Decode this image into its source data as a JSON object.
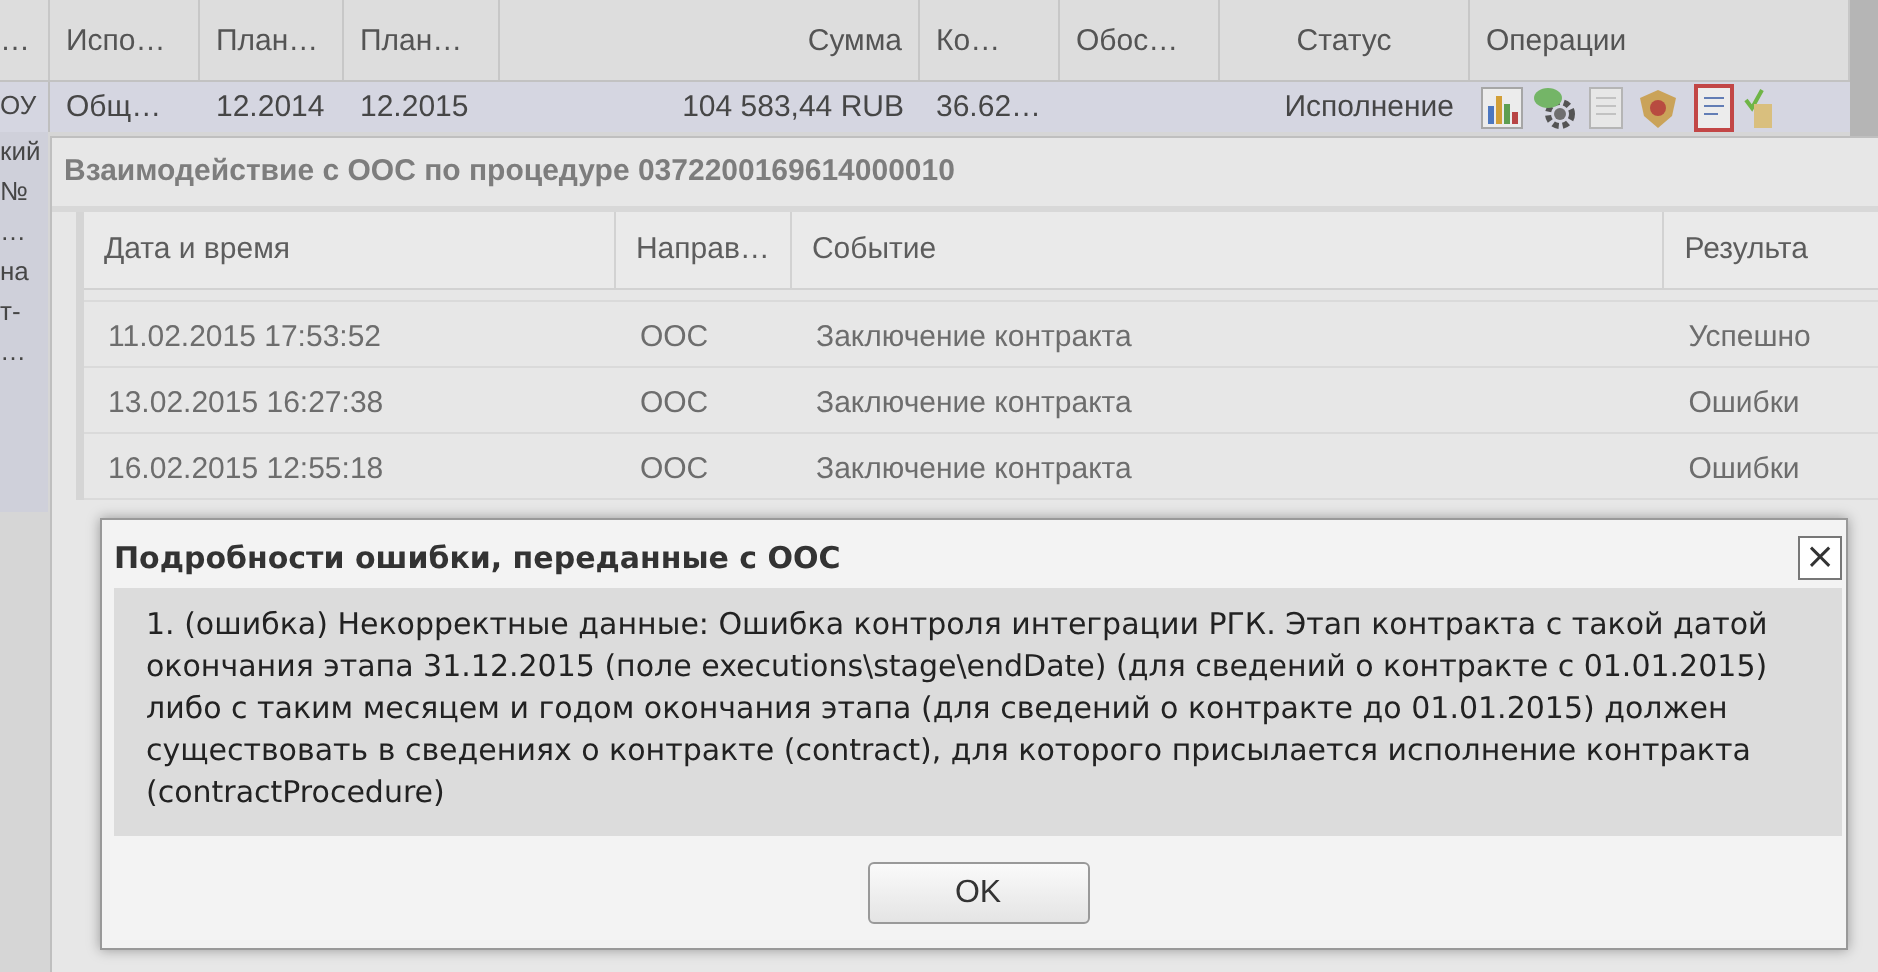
{
  "main_grid": {
    "columns": [
      "…",
      "Испо…",
      "План…",
      "План…",
      "Сумма",
      "Ко…",
      "Обос…",
      "Статус",
      "Операции"
    ],
    "row": {
      "selected": true,
      "first_cell_lines": [
        "ОУ",
        "кий",
        "№",
        "…",
        "на",
        "т-",
        "…"
      ],
      "cells": [
        "Общ…",
        "12.2014",
        "12.2015",
        "104 583,44 RUB",
        "36.62…",
        "",
        "Исполнение"
      ]
    }
  },
  "interaction_window": {
    "title": "Взаимодействие с ООС по процедуре 0372200169614000010",
    "columns": [
      "Дата и время",
      "Направ…",
      "Событие",
      "Результа"
    ],
    "rows": [
      {
        "cells": [
          "11.02.2015 17:53:52",
          "ООС",
          "Заключение контракта",
          "Успешно"
        ]
      },
      {
        "cells": [
          "13.02.2015 16:27:38",
          "ООС",
          "Заключение контракта",
          "Ошибки"
        ]
      },
      {
        "cells": [
          "16.02.2015 12:55:18",
          "ООС",
          "Заключение контракта",
          "Ошибки"
        ]
      }
    ]
  },
  "error_dialog": {
    "title": "Подробности ошибки, переданные с ООС",
    "close": "×",
    "message": "1. (ошибка) Некорректные данные: Ошибка контроля интеграции РГК. Этап контракта с такой датой окончания этапа 31.12.2015 (поле executions\\stage\\endDate) (для сведений о контракте с 01.01.2015) либо с таким месяцем и годом окончания этапа (для сведений о контракте до 01.01.2015) должен существовать в сведениях о контракте (contract), для которого присылается исполнение контракта (contractProcedure)",
    "button": "OK"
  }
}
